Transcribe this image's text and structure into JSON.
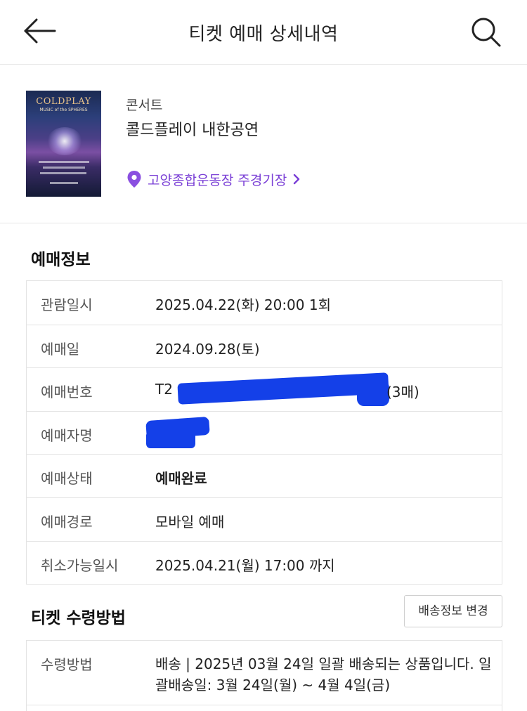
{
  "header": {
    "title": "티켓 예매 상세내역",
    "back_icon": "arrow-left-icon",
    "search_icon": "search-icon"
  },
  "event": {
    "poster": {
      "title": "COLDPLAY",
      "subtitle": "MUSIC of the SPHERES"
    },
    "category": "콘서트",
    "name": "콜드플레이 내한공연",
    "venue": "고양종합운동장 주경기장",
    "accent_color": "#7a3fd6"
  },
  "booking_info": {
    "section_title": "예매정보",
    "rows": [
      {
        "label": "관람일시",
        "value": "2025.04.22(화) 20:00 1회"
      },
      {
        "label": "예매일",
        "value": "2024.09.28(토)"
      },
      {
        "label": "예매번호",
        "value_prefix": "T2",
        "value_suffix": "(3매)"
      },
      {
        "label": "예매자명",
        "value": ""
      },
      {
        "label": "예매상태",
        "value": "예매완료"
      },
      {
        "label": "예매경로",
        "value": "모바일 예매"
      },
      {
        "label": "취소가능일시",
        "value": "2025.04.21(월) 17:00 까지"
      }
    ]
  },
  "delivery": {
    "section_title": "티켓 수령방법",
    "change_button": "배송정보 변경",
    "label": "수령방법",
    "value": "배송 | 2025년 03월 24일 일괄 배송되는 상품입니다. 일괄배송일: 3월 24일(월) ~ 4월 4일(금)"
  },
  "colors": {
    "redaction": "#1440e8",
    "border": "#e3e3e3"
  }
}
